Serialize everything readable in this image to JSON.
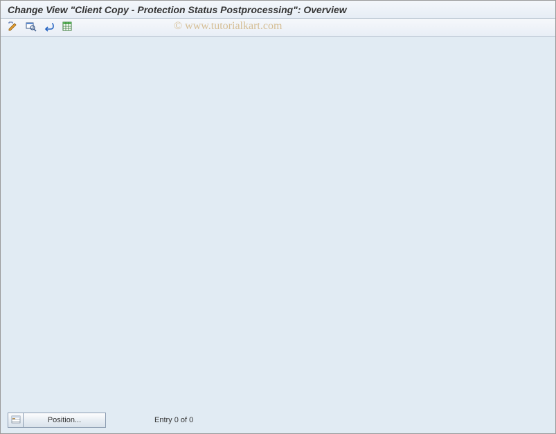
{
  "title": "Change View \"Client Copy - Protection Status Postprocessing\": Overview",
  "toolbar": {
    "icons": [
      {
        "name": "toggle-display-change-icon"
      },
      {
        "name": "find-icon"
      },
      {
        "name": "undo-icon"
      },
      {
        "name": "select-all-icon"
      }
    ]
  },
  "bottom": {
    "position_label": "Position...",
    "entry_text": "Entry 0 of 0"
  },
  "watermark": "© www.tutorialkart.com"
}
